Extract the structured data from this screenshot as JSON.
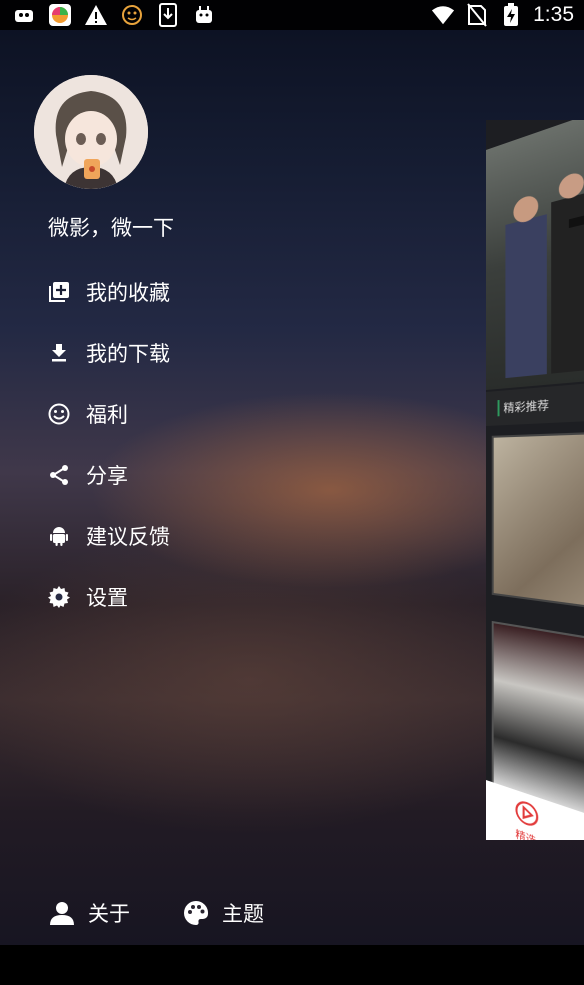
{
  "status_bar": {
    "time": "1:35",
    "left_icons": [
      "ghost-app-icon",
      "colorful-app-icon",
      "warning-icon",
      "emoji-face-icon",
      "download-box-icon",
      "android-robot-icon"
    ],
    "right_icons": [
      "wifi-icon",
      "no-sim-icon",
      "battery-charging-icon"
    ]
  },
  "drawer": {
    "slogan": "微影，微一下",
    "menu": [
      {
        "label": "我的收藏",
        "icon": "library-add-icon"
      },
      {
        "label": "我的下载",
        "icon": "download-icon"
      },
      {
        "label": "福利",
        "icon": "smiley-icon"
      },
      {
        "label": "分享",
        "icon": "share-icon"
      },
      {
        "label": "建议反馈",
        "icon": "android-icon"
      },
      {
        "label": "设置",
        "icon": "gear-icon"
      }
    ],
    "bottom": [
      {
        "label": "关于",
        "icon": "person-icon"
      },
      {
        "label": "主题",
        "icon": "palette-icon"
      }
    ]
  },
  "preview": {
    "section_label": "精彩推荐",
    "tab_label": "精选"
  },
  "colors": {
    "accent_green": "#2e9a5e",
    "tab_red": "#e23b3b"
  }
}
